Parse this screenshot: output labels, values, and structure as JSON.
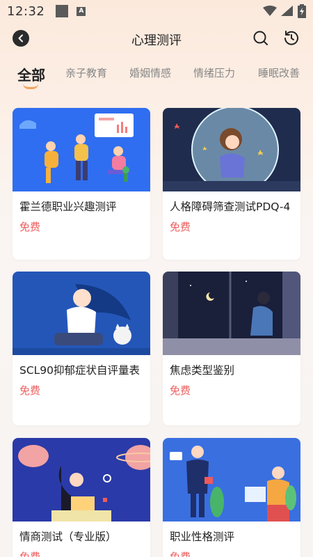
{
  "status_bar": {
    "time": "12:32",
    "badge": "A"
  },
  "header": {
    "title": "心理测评"
  },
  "tabs": [
    {
      "label": "全部",
      "active": true
    },
    {
      "label": "亲子教育",
      "active": false
    },
    {
      "label": "婚姻情感",
      "active": false
    },
    {
      "label": "情绪压力",
      "active": false
    },
    {
      "label": "睡眠改善",
      "active": false
    }
  ],
  "colors": {
    "accent": "#f2a25c",
    "price": "#ef5d5d"
  },
  "cards": [
    {
      "title": "霍兰德职业兴趣测评",
      "price": "免费"
    },
    {
      "title": "人格障碍筛查测试PDQ-4",
      "price": "免费"
    },
    {
      "title": "SCL90抑郁症状自评量表",
      "price": "免费"
    },
    {
      "title": "焦虑类型鉴别",
      "price": "免费"
    },
    {
      "title": "情商测试（专业版）",
      "price": "免费"
    },
    {
      "title": "职业性格测评",
      "price": "免费"
    }
  ]
}
